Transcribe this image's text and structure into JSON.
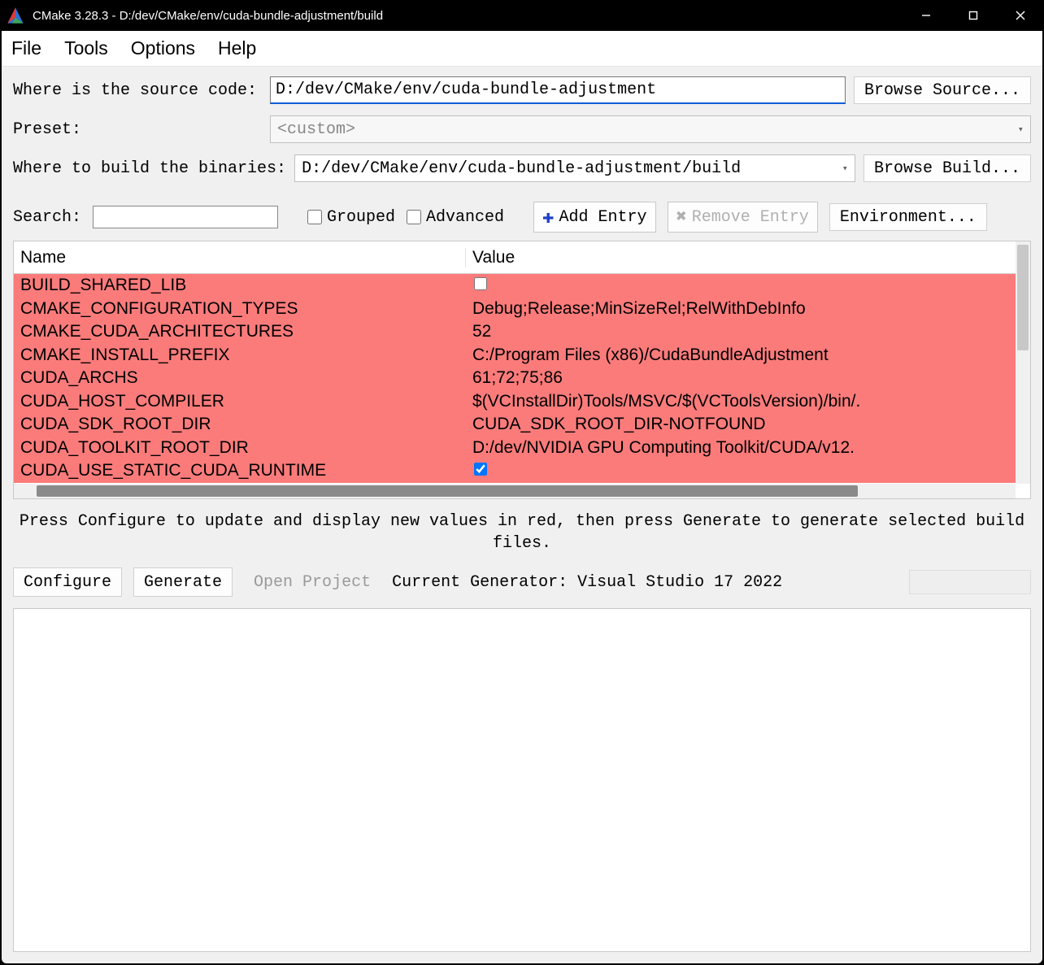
{
  "title": "CMake 3.28.3 - D:/dev/CMake/env/cuda-bundle-adjustment/build",
  "menu": {
    "file": "File",
    "tools": "Tools",
    "options": "Options",
    "help": "Help"
  },
  "labels": {
    "source": "Where is the source code:",
    "preset": "Preset:",
    "build": "Where to build the binaries:",
    "search": "Search:",
    "grouped": "Grouped",
    "advanced": "Advanced",
    "name_col": "Name",
    "value_col": "Value"
  },
  "paths": {
    "source": "D:/dev/CMake/env/cuda-bundle-adjustment",
    "preset": "<custom>",
    "build": "D:/dev/CMake/env/cuda-bundle-adjustment/build"
  },
  "buttons": {
    "browse_source": "Browse Source...",
    "browse_build": "Browse Build...",
    "add_entry": "Add Entry",
    "remove_entry": "Remove Entry",
    "environment": "Environment...",
    "configure": "Configure",
    "generate": "Generate",
    "open_project": "Open Project"
  },
  "cache": [
    {
      "name": "BUILD_SHARED_LIB",
      "value": "",
      "type": "bool",
      "checked": false
    },
    {
      "name": "CMAKE_CONFIGURATION_TYPES",
      "value": "Debug;Release;MinSizeRel;RelWithDebInfo",
      "type": "string"
    },
    {
      "name": "CMAKE_CUDA_ARCHITECTURES",
      "value": "52",
      "type": "string"
    },
    {
      "name": "CMAKE_INSTALL_PREFIX",
      "value": "C:/Program Files (x86)/CudaBundleAdjustment",
      "type": "string"
    },
    {
      "name": "CUDA_ARCHS",
      "value": "61;72;75;86",
      "type": "string"
    },
    {
      "name": "CUDA_HOST_COMPILER",
      "value": "$(VCInstallDir)Tools/MSVC/$(VCToolsVersion)/bin/.",
      "type": "string"
    },
    {
      "name": "CUDA_SDK_ROOT_DIR",
      "value": "CUDA_SDK_ROOT_DIR-NOTFOUND",
      "type": "string"
    },
    {
      "name": "CUDA_TOOLKIT_ROOT_DIR",
      "value": "D:/dev/NVIDIA GPU Computing Toolkit/CUDA/v12.",
      "type": "string"
    },
    {
      "name": "CUDA_USE_STATIC_CUDA_RUNTIME",
      "value": "",
      "type": "bool",
      "checked": true
    }
  ],
  "hint": "Press Configure to update and display new values in red, then press Generate to generate selected build files.",
  "generator": "Current Generator: Visual Studio 17 2022"
}
